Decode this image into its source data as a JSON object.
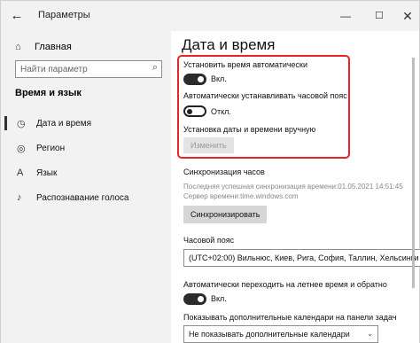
{
  "window": {
    "title": "Параметры",
    "back_icon": "←",
    "minimize_icon": "—",
    "maximize_icon": "☐",
    "close_icon": "✕"
  },
  "sidebar": {
    "home_icon": "⌂",
    "home_label": "Главная",
    "search_placeholder": "Найти параметр",
    "search_icon": "⌕",
    "section_title": "Время и язык",
    "items": [
      {
        "icon": "◷",
        "label": "Дата и время",
        "active": true
      },
      {
        "icon": "◎",
        "label": "Регион",
        "active": false
      },
      {
        "icon": "A",
        "label": "Язык",
        "active": false
      },
      {
        "icon": "♪",
        "label": "Распознавание голоса",
        "active": false
      }
    ]
  },
  "main": {
    "title": "Дата и время",
    "auto_time": {
      "label": "Установить время автоматически",
      "state": "Вкл.",
      "on": true
    },
    "auto_tz": {
      "label": "Автоматически устанавливать часовой пояс",
      "state": "Откл.",
      "on": false
    },
    "manual": {
      "label": "Установка даты и времени вручную",
      "button": "Изменить"
    },
    "sync": {
      "title": "Синхронизация часов",
      "last_sync": "Последняя успешная синхронизация времени:01.05.2021 14:51:45",
      "server": "Сервер времени:time.windows.com",
      "button": "Синхронизировать"
    },
    "timezone": {
      "label": "Часовой пояс",
      "value": "(UTC+02:00) Вильнюс, Киев, Рига, София, Таллин, Хельсинки",
      "chevron": "⌄"
    },
    "dst": {
      "label": "Автоматически переходить на летнее время и обратно",
      "state": "Вкл.",
      "on": true
    },
    "calendars": {
      "label": "Показывать дополнительные календари на панели задач",
      "value": "Не показывать дополнительные календари",
      "chevron": "⌄"
    }
  },
  "colors": {
    "highlight": "#e8242a",
    "toggle_on": "#2b2b2b",
    "sidebar_bg": "#f2f2f2"
  }
}
